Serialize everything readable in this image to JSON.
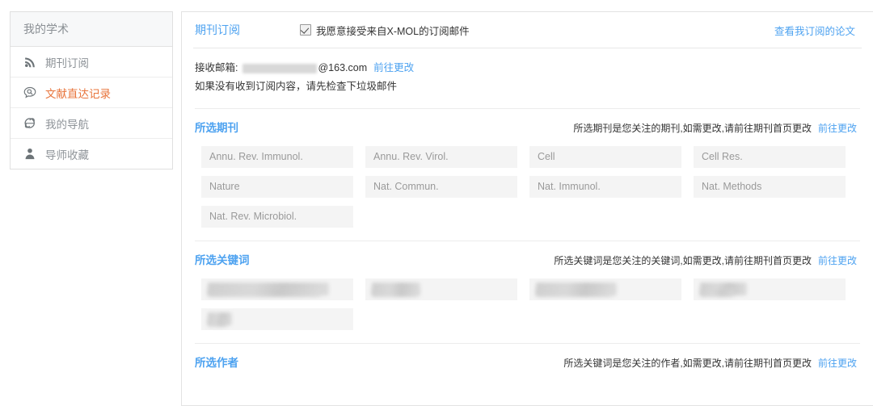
{
  "sidebar": {
    "header": "我的学术",
    "items": [
      {
        "label": "期刊订阅",
        "icon": "rss-icon",
        "active": false
      },
      {
        "label": "文献直达记录",
        "icon": "search-bubble-icon",
        "active": true
      },
      {
        "label": "我的导航",
        "icon": "browser-compass-icon",
        "active": false
      },
      {
        "label": "导师收藏",
        "icon": "user-tie-icon",
        "active": false
      }
    ]
  },
  "topbar": {
    "title": "期刊订阅",
    "consent_label": "我愿意接受来自X-MOL的订阅邮件",
    "consent_checked": true,
    "view_link": "查看我订阅的论文"
  },
  "mailbox": {
    "label": "接收邮箱:",
    "address_masked": "",
    "domain": "@163.com",
    "change_link": "前往更改",
    "note": "如果没有收到订阅内容，请先检查下垃圾邮件"
  },
  "sections": [
    {
      "id": "journals",
      "title": "所选期刊",
      "note": "所选期刊是您关注的期刊,如需更改,请前往期刊首页更改",
      "link": "前往更改",
      "tags": [
        {
          "label": "Annu. Rev. Immunol.",
          "blurred": false
        },
        {
          "label": "Annu. Rev. Virol.",
          "blurred": false
        },
        {
          "label": "Cell",
          "blurred": false
        },
        {
          "label": "Cell Res.",
          "blurred": false
        },
        {
          "label": "Nature",
          "blurred": false
        },
        {
          "label": "Nat. Commun.",
          "blurred": false
        },
        {
          "label": "Nat. Immunol.",
          "blurred": false
        },
        {
          "label": "Nat. Methods",
          "blurred": false
        },
        {
          "label": "Nat. Rev. Microbiol.",
          "blurred": false
        }
      ]
    },
    {
      "id": "keywords",
      "title": "所选关键词",
      "note": "所选关键词是您关注的关键词,如需更改,请前往期刊首页更改",
      "link": "前往更改",
      "tags": [
        {
          "label": "",
          "blurred": true,
          "w1": 150,
          "w2": 140
        },
        {
          "label": "",
          "blurred": true,
          "w1": 60,
          "w2": 58
        },
        {
          "label": "",
          "blurred": true,
          "w1": 100,
          "w2": 95
        },
        {
          "label": "",
          "blurred": true,
          "w1": 58,
          "w2": 42
        },
        {
          "label": "",
          "blurred": true,
          "w1": 30,
          "w2": 24
        }
      ]
    },
    {
      "id": "authors",
      "title": "所选作者",
      "note": "所选关键词是您关注的作者,如需更改,请前往期刊首页更改",
      "link": "前往更改",
      "tags": []
    }
  ],
  "colors": {
    "accent_blue": "#4da2f0",
    "active_orange": "#e8743b",
    "tag_bg": "#f4f4f4",
    "tag_text": "#9a9a9a",
    "border": "#e3e3e3"
  }
}
